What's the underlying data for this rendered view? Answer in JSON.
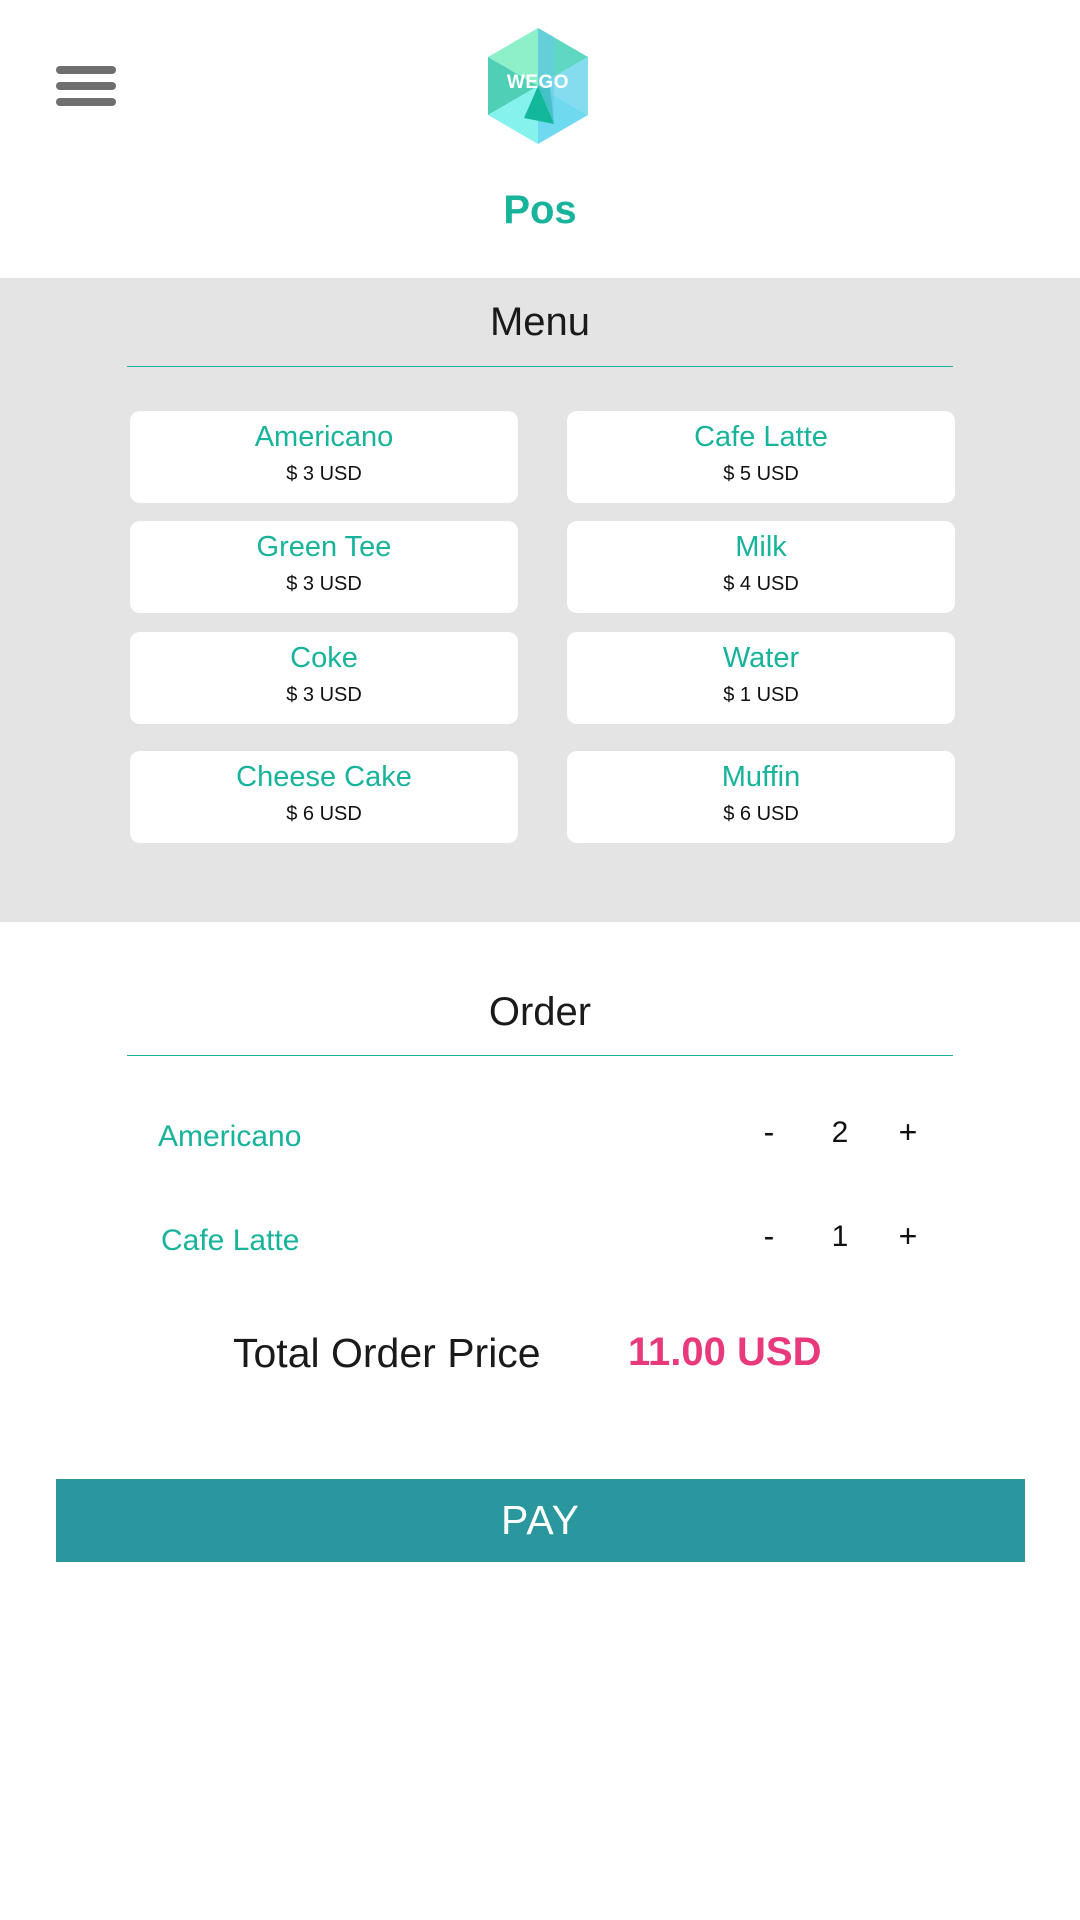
{
  "header": {
    "logo_text": "WEGO",
    "title": "Pos"
  },
  "menu": {
    "heading": "Menu",
    "items": [
      {
        "name": "Americano",
        "price": "$ 3 USD"
      },
      {
        "name": "Cafe Latte",
        "price": "$ 5 USD"
      },
      {
        "name": "Green Tee",
        "price": "$ 3 USD"
      },
      {
        "name": "Milk",
        "price": "$ 4 USD"
      },
      {
        "name": "Coke",
        "price": "$ 3 USD"
      },
      {
        "name": "Water",
        "price": "$ 1 USD"
      },
      {
        "name": "Cheese Cake",
        "price": "$ 6 USD"
      },
      {
        "name": "Muffin",
        "price": "$ 6 USD"
      }
    ]
  },
  "order": {
    "heading": "Order",
    "items": [
      {
        "name": "Americano",
        "minus": "-",
        "quantity": "2",
        "plus": "+"
      },
      {
        "name": "Cafe Latte",
        "minus": "-",
        "quantity": "1",
        "plus": "+"
      }
    ],
    "total_label": "Total Order Price",
    "total_value": "11.00 USD"
  },
  "pay_label": "PAY",
  "colors": {
    "accent": "#17b39b",
    "pay_button": "#29979d",
    "total_price": "#e8397d",
    "menu_background": "#e4e4e4"
  },
  "icons": {
    "menu": "hamburger-icon",
    "logo": "hexagon-logo"
  }
}
